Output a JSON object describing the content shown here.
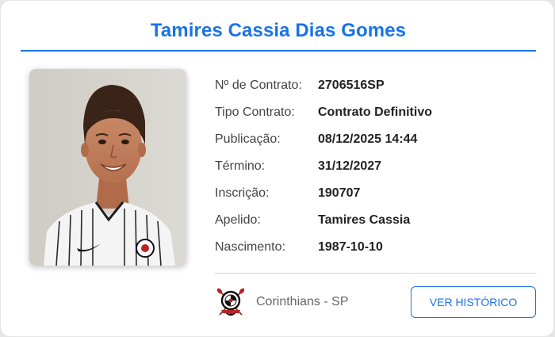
{
  "player": {
    "name": "Tamires Cassia Dias Gomes"
  },
  "details": [
    {
      "label": "Nº de Contrato:",
      "value": "2706516SP"
    },
    {
      "label": "Tipo Contrato:",
      "value": "Contrato Definitivo"
    },
    {
      "label": "Publicação:",
      "value": "08/12/2025 14:44"
    },
    {
      "label": "Término:",
      "value": "31/12/2027"
    },
    {
      "label": "Inscrição:",
      "value": "190707"
    },
    {
      "label": "Apelido:",
      "value": "Tamires Cassia"
    },
    {
      "label": "Nascimento:",
      "value": "1987-10-10"
    }
  ],
  "club": {
    "name": "Corinthians - SP",
    "badge_icon": "corinthians-badge-icon"
  },
  "actions": {
    "history_label": "VER HISTÓRICO"
  },
  "colors": {
    "accent": "#1a73e8",
    "label_text": "#444444",
    "value_text": "#222222",
    "card_background": "#ffffff",
    "page_background": "#e6e6e6"
  }
}
